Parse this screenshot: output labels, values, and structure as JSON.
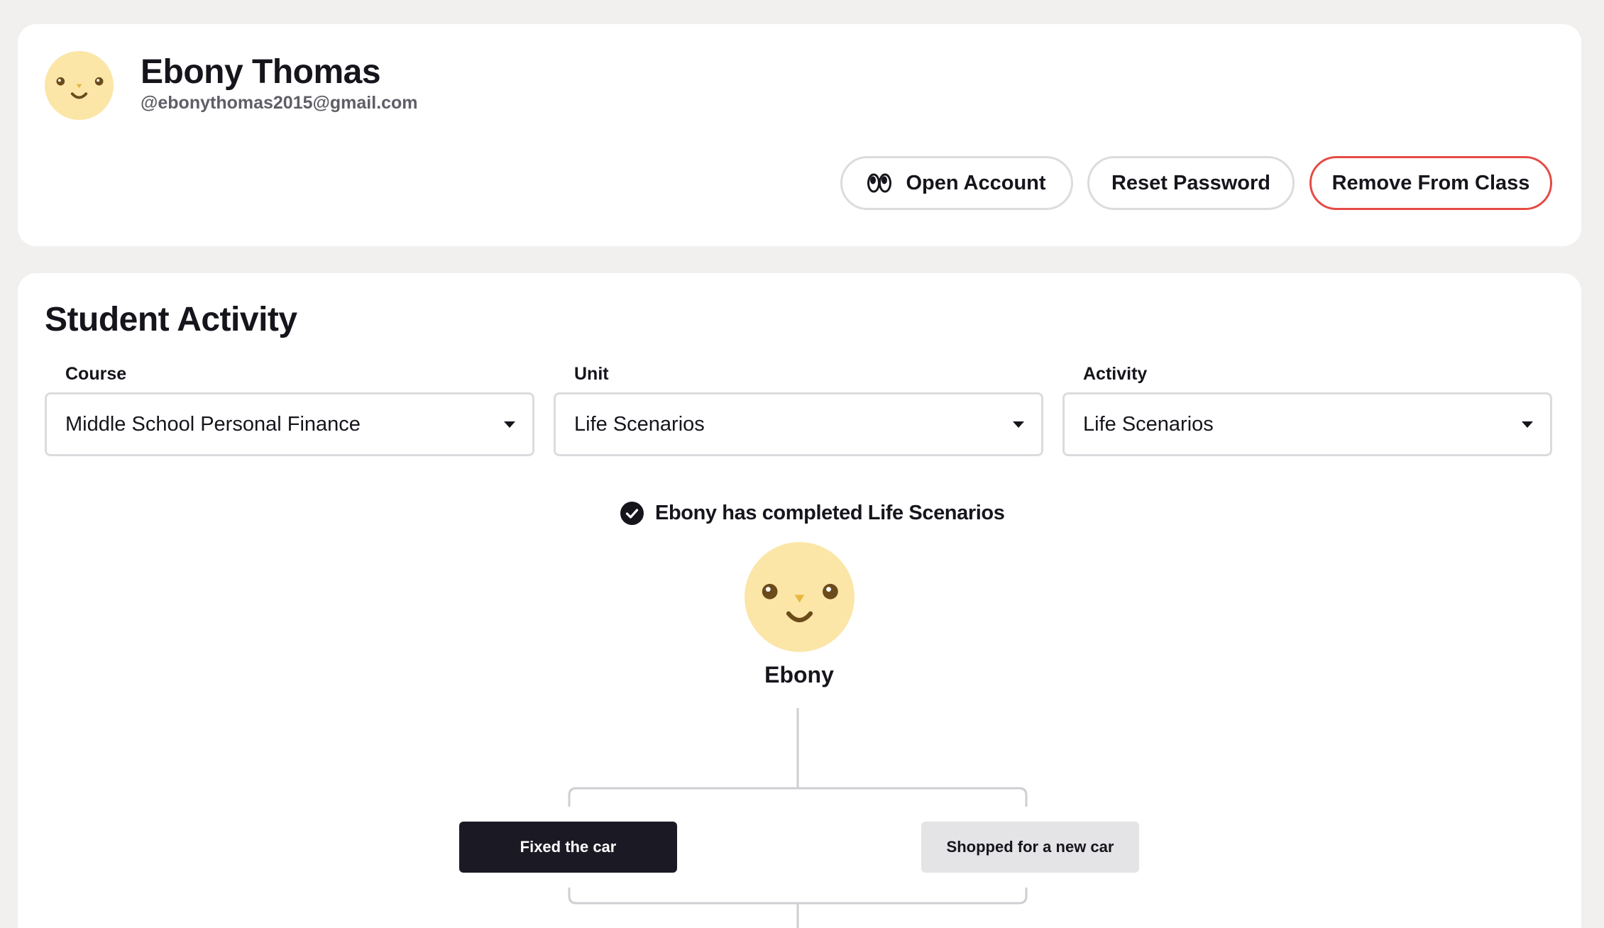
{
  "profile": {
    "name": "Ebony Thomas",
    "email": "@ebonythomas2015@gmail.com",
    "buttons": {
      "open_account": "Open Account",
      "reset_password": "Reset Password",
      "remove_from_class": "Remove From Class"
    }
  },
  "activity": {
    "title": "Student Activity",
    "filters": {
      "course": {
        "label": "Course",
        "value": "Middle School Personal Finance"
      },
      "unit": {
        "label": "Unit",
        "value": "Life Scenarios"
      },
      "activity": {
        "label": "Activity",
        "value": "Life Scenarios"
      }
    },
    "completion_text": "Ebony has completed Life Scenarios",
    "avatar_name": "Ebony",
    "choices": {
      "selected": "Fixed the car",
      "other": "Shopped for a new car"
    }
  },
  "colors": {
    "background": "#f1f0ee",
    "card": "#ffffff",
    "avatar_face": "#fbe6a8",
    "remove_accent": "#e64b45",
    "selected_choice": "#1b1a24",
    "unselected_choice": "#e4e3e5"
  },
  "icons": {
    "open_account": "eyes-icon",
    "completed": "check-circle-icon",
    "dropdown": "caret-down-icon"
  }
}
